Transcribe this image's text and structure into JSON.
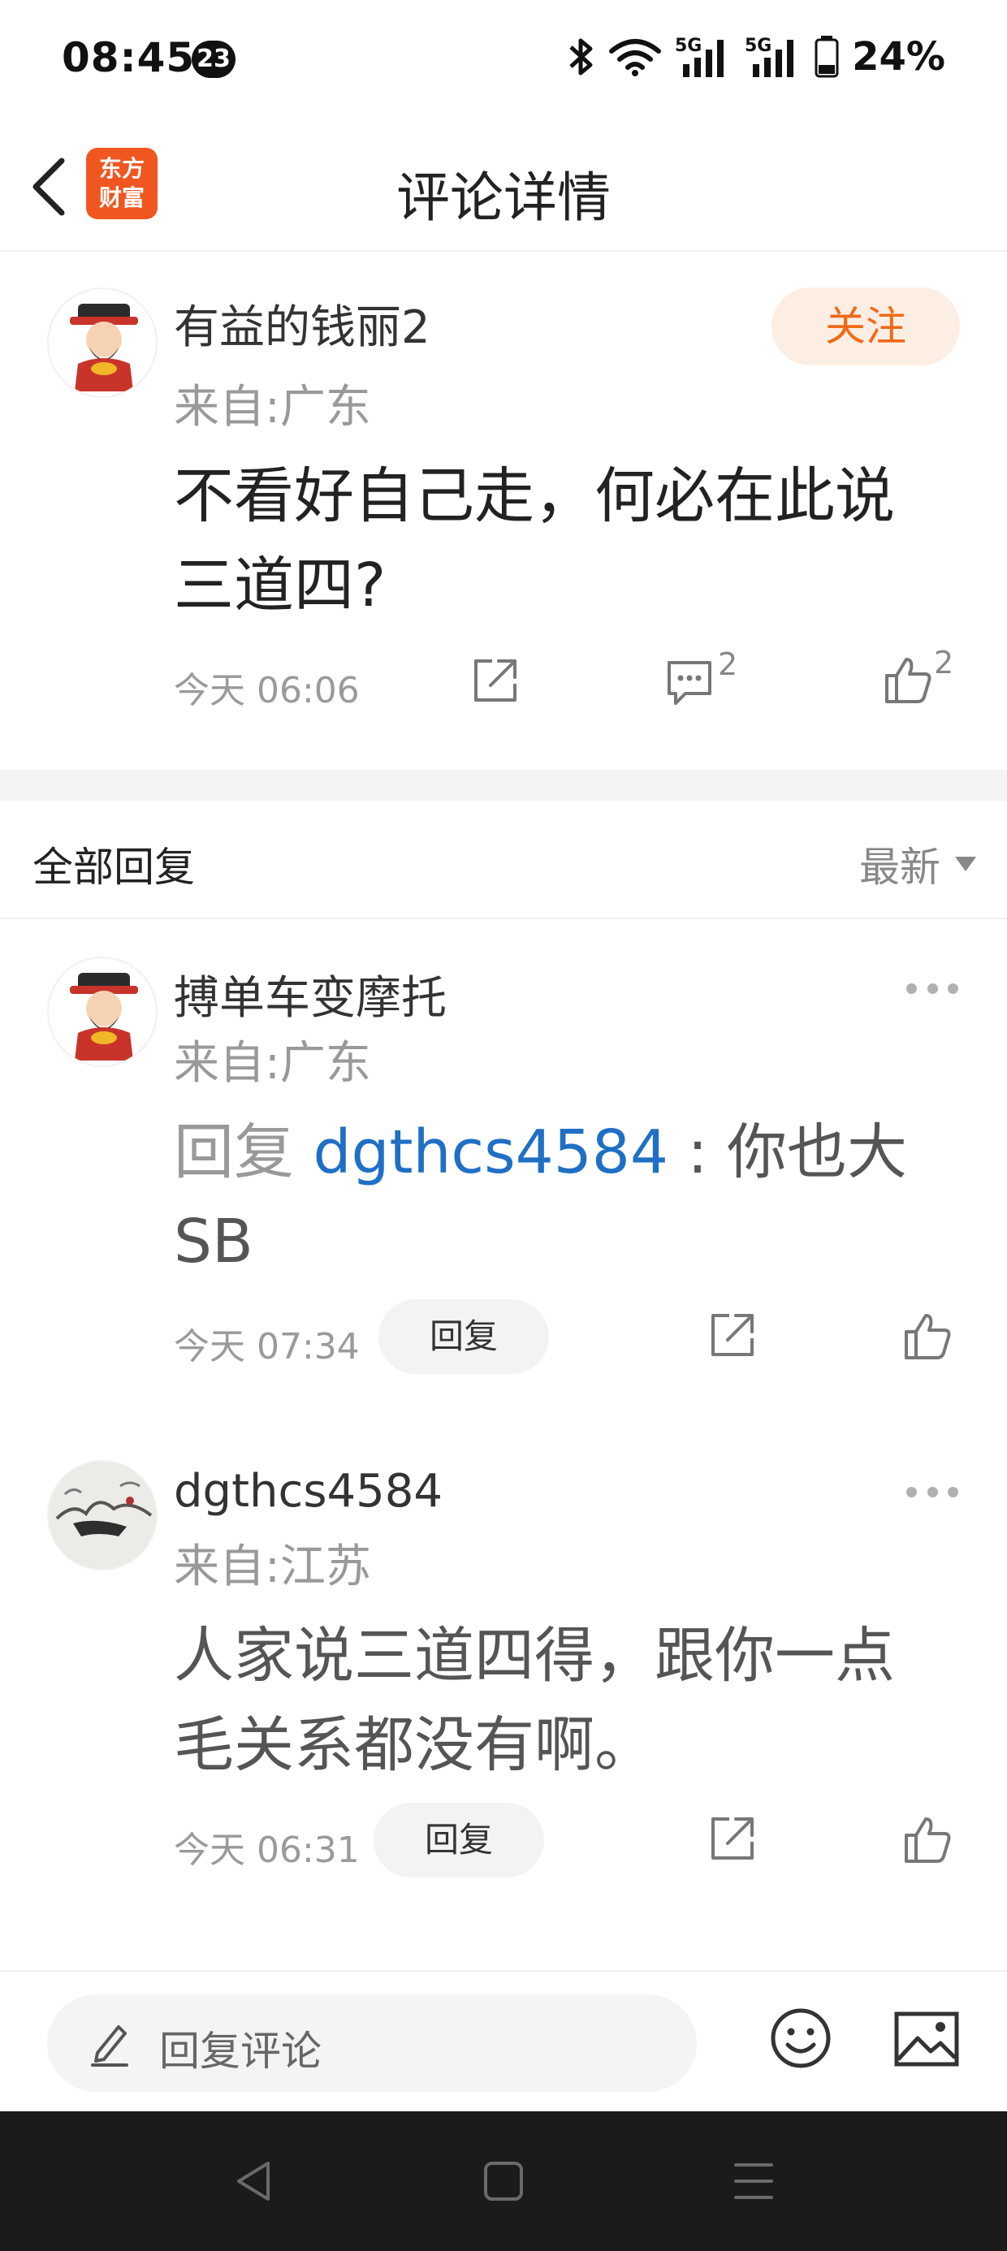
{
  "status_bar": {
    "time": "08:45",
    "notification_count": "23",
    "battery": "24%",
    "network_1": "5G",
    "network_2": "5G"
  },
  "header": {
    "title": "评论详情",
    "logo_text": "东方财富"
  },
  "main_comment": {
    "username": "有益的钱丽2",
    "location": "来自:广东",
    "follow_label": "关注",
    "content": "不看好自己走，何必在此说三道四?",
    "time": "今天 06:06",
    "comment_count": "2",
    "like_count": "2"
  },
  "replies_section": {
    "title": "全部回复",
    "sort_label": "最新"
  },
  "replies": [
    {
      "username": "搏单车变摩托",
      "location": "来自:广东",
      "reply_prefix": "回复",
      "mention": "dgthcs4584",
      "content": " : 你也大SB",
      "time": "今天 07:34",
      "reply_label": "回复"
    },
    {
      "username": "dgthcs4584",
      "location": "来自:江苏",
      "content": "人家说三道四得，跟你一点毛关系都没有啊。",
      "time": "今天 06:31",
      "reply_label": "回复"
    }
  ],
  "input_bar": {
    "placeholder": "回复评论"
  },
  "colors": {
    "accent": "#ef6a16",
    "follow_bg": "#fdeee4",
    "mention": "#1f6fc5",
    "logo": "#f0561f"
  }
}
